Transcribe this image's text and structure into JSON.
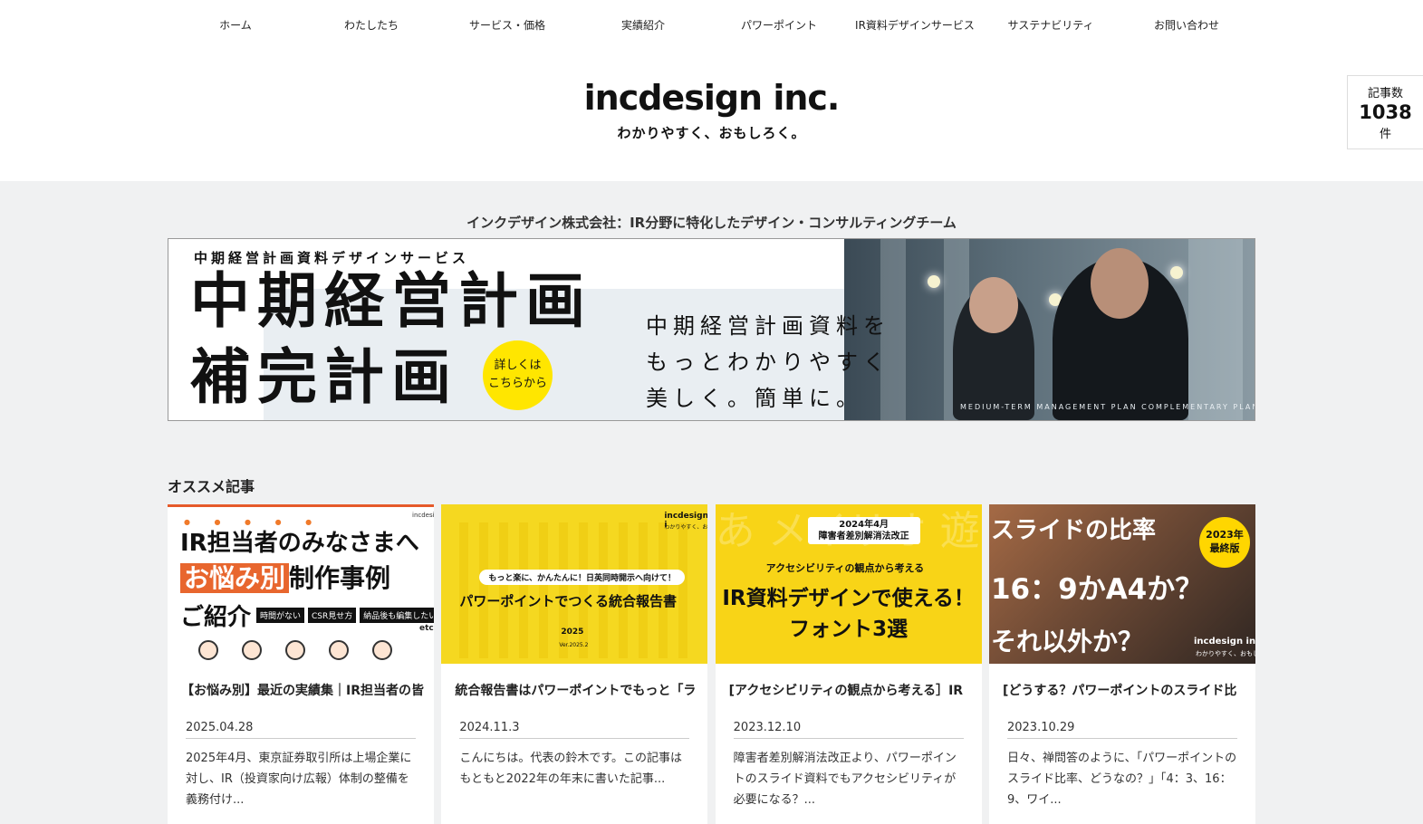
{
  "nav": [
    "ホーム",
    "わたしたち",
    "サービス・価格",
    "実績紹介",
    "パワーポイント",
    "IR資料デザインサービス",
    "サステナビリティ",
    "お問い合わせ"
  ],
  "logo": {
    "name": "incdesign inc.",
    "tagline": "わかりやすく、おもしろく。"
  },
  "article_count": {
    "label": "記事数",
    "value": "1038",
    "unit": "件"
  },
  "company_tagline": "インクデザイン株式会社：IR分野に特化したデザイン・コンサルティングチーム",
  "banner": {
    "subtitle": "中期経営計画資料デザインサービス",
    "line1": "中期経営計画",
    "line2": "補完計画",
    "button": [
      "詳しくは",
      "こちらから"
    ],
    "copy": [
      "中期経営計画資料を",
      "もっとわかりやすく",
      "美しく。簡単に。"
    ],
    "caption": "MEDIUM-TERM MANAGEMENT PLAN COMPLEMENTARY PLAN"
  },
  "section_title": "オススメ記事",
  "cards": [
    {
      "title": "【お悩み別】最近の実績集｜IR担当者の皆",
      "date": "2025.04.28",
      "excerpt": "2025年4月、東京証券取引所は上場企業に対し、IR（投資家向け広報）体制の整備を義務付け...",
      "thumb": {
        "logo": "incdesign",
        "dots": "● ● ● ● ●",
        "l1": "IR担当者のみなさまへ",
        "hl": "お悩み別",
        "l2rest": "制作事例",
        "l3": "ご紹介",
        "tags": [
          "時間がない",
          "CSR見せ方",
          "納品後も編集したい"
        ],
        "etc": "etc"
      }
    },
    {
      "title": "統合報告書はパワーポイントでもっと「ラ",
      "date": "2024.11.3",
      "excerpt": "こんにちは。代表の鈴木です。この記事はもともと2022年の年末に書いた記事...",
      "thumb": {
        "logo": "incdesign i",
        "logo_sub": "わかりやすく、お",
        "pill": "もっと楽に、かんたんに！日英同時開示へ向けて！",
        "main": "パワーポイントでつくる統合報告書",
        "year": "2025",
        "ver": "Ver.2025.2"
      }
    },
    {
      "title": "[アクセシビリティの観点から考える］IR",
      "date": "2023.12.10",
      "excerpt": "障害者差別解消法改正より、パワーポイントのスライド資料でもアクセシビリティが必要になる？...",
      "thumb": {
        "bg": "あ メイリオ 遊 サ ゴシック 朝",
        "box": [
          "2024年4月",
          "障害者差別解消法改正"
        ],
        "m1": "アクセシビリティの観点から考える",
        "m2": "IR資料デザインで使える！",
        "m3": "フォント3選"
      }
    },
    {
      "title": "[どうする？パワーポイントのスライド比",
      "date": "2023.10.29",
      "excerpt": "日々、禅問答のように、「パワーポイントのスライド比率、どうなの？」「4：3、16：9、ワイ...",
      "thumb": {
        "h1": "スライドの比率",
        "h2": "16：9かA4か？",
        "h3": "それ以外か？",
        "badge": [
          "2023年",
          "最終版"
        ],
        "logo": "incdesign inc",
        "logo_sub": "わかりやすく、おもしろく。"
      }
    }
  ],
  "colors": {
    "accent_yellow": "#ffe600",
    "orange": "#e8662e",
    "page_bg": "#f0f1f2"
  }
}
